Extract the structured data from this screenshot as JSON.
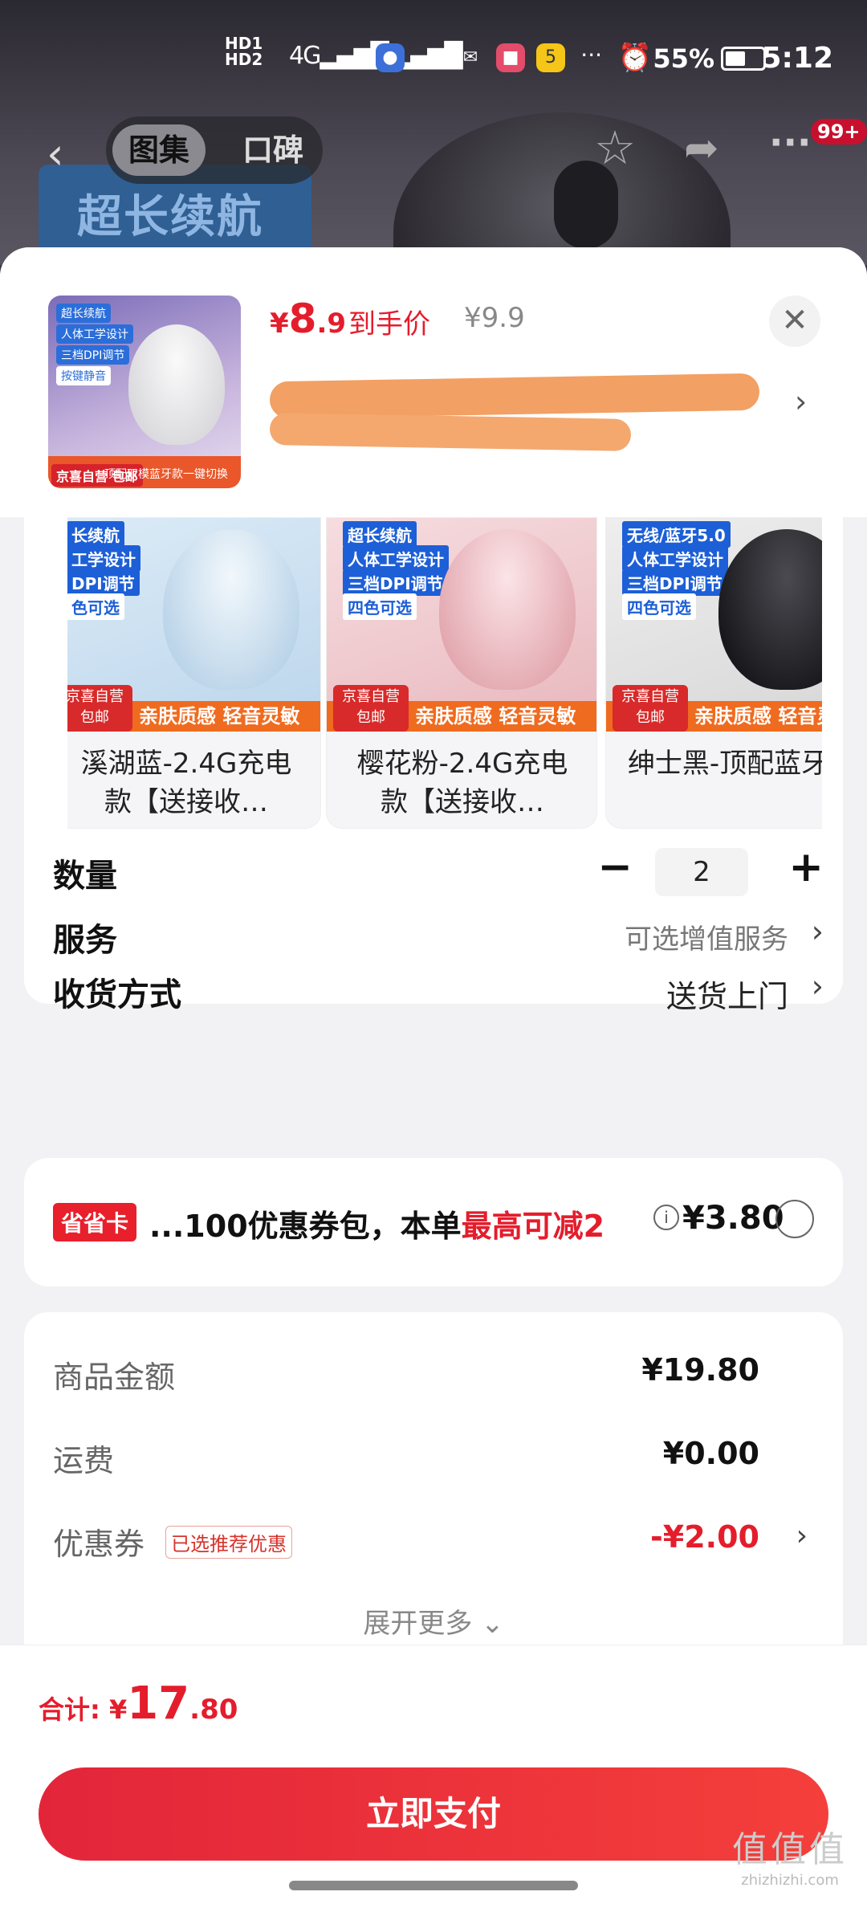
{
  "status_bar": {
    "time": "5:12",
    "battery_pct": "55%",
    "network": "HD",
    "more_indicator": "···"
  },
  "nav": {
    "tabs": [
      "图集",
      "口碑"
    ],
    "badge": "99+",
    "bg_banner": "超长续航"
  },
  "product": {
    "price_symbol": "¥",
    "price_int": "8",
    "price_dec": ".9",
    "price_label": "到手价",
    "original_price": "¥9.9",
    "thumb_tags": [
      "超长续航",
      "人体工学设计",
      "三档DPI调节",
      "按键静音"
    ],
    "thumb_badge": "京喜自营 包邮",
    "thumb_footer": "顶配双模蓝牙款一键切换"
  },
  "variants": [
    {
      "label": "溪湖蓝-2.4G充电款【送接收…",
      "tags": [
        "长续航",
        "工学设计",
        "DPI调节",
        "色可选"
      ],
      "bar": "亲肤质感 轻音灵敏",
      "badge": "京喜自营 包邮",
      "color": "#cfe4f4"
    },
    {
      "label": "樱花粉-2.4G充电款【送接收…",
      "tags": [
        "超长续航",
        "人体工学设计",
        "三档DPI调节",
        "四色可选"
      ],
      "bar": "亲肤质感 轻音灵敏",
      "badge": "京喜自营 包邮",
      "color": "#f1c6cc"
    },
    {
      "label": "绅士黑-顶配蓝牙款",
      "tags": [
        "无线/蓝牙5.0",
        "人体工学设计",
        "三档DPI调节",
        "四色可选"
      ],
      "bar": "亲肤质感 轻音灵敏",
      "badge": "京喜自营 包邮",
      "color": "#2a2a2e"
    }
  ],
  "options": {
    "quantity_label": "数量",
    "quantity_value": "2",
    "minus": "−",
    "plus": "+",
    "service_label": "服务",
    "service_value": "可选增值服务",
    "delivery_label": "收货方式",
    "delivery_value": "送货上门"
  },
  "saving_card": {
    "badge": "省省卡",
    "text_prefix": "...100优惠券包，本单",
    "text_highlight": "最高可减2",
    "price": "¥3.80"
  },
  "summary": {
    "goods_label": "商品金额",
    "goods_value": "¥19.80",
    "shipping_label": "运费",
    "shipping_value": "¥0.00",
    "coupon_label": "优惠券",
    "coupon_tag": "已选推荐优惠",
    "coupon_value": "-¥2.00",
    "expand_label": "展开更多"
  },
  "footer": {
    "total_label": "合计: ¥",
    "total_int": "17",
    "total_dec": ".80",
    "pay_button": "立即支付"
  },
  "watermark": {
    "big": "值值值",
    "small": "zhizhizhi.com"
  },
  "colors": {
    "accent": "#e41d2c",
    "button": "#f03a3c"
  }
}
